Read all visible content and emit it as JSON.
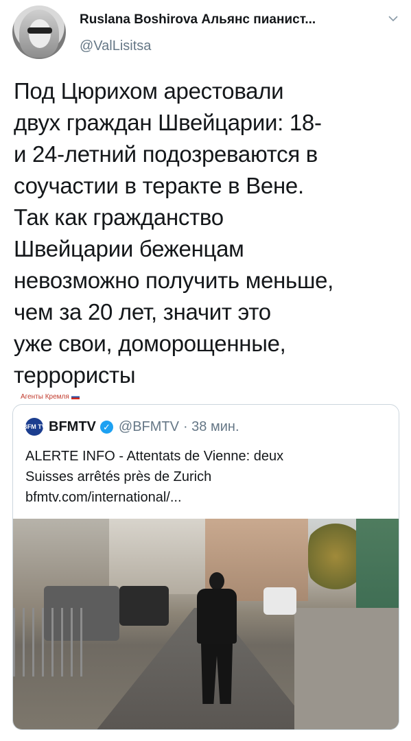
{
  "tweet": {
    "display_name": "Ruslana Boshirova Альянс пианист...",
    "handle": "@ValLisitsa",
    "text": "Под Цюрихом арестовали\nдвух граждан Швейцарии: 18-\nи 24-летний подозреваются в\nсоучастии в теракте в Вене.\nТак как гражданство\nШвейцарии беженцам\nневозможно получить меньше,\nчем за 20 лет, значит это\nуже свои, доморощенные,\nтеррористы",
    "more_icon": "chevron-down-icon"
  },
  "watermark": {
    "text": "Агенты Кремля"
  },
  "quoted": {
    "logo_text": "BFM TV",
    "name": "BFMTV",
    "handle": "@BFMTV",
    "time": "· 38 мин.",
    "text": "ALERTE INFO - Attentats de Vienne: deux\nSuisses arrêtés près de Zurich\nbfmtv.com/international/...",
    "image_desc": "police-officer-street-photo"
  },
  "colors": {
    "text": "#14171a",
    "secondary": "#657786",
    "verified": "#1da1f2",
    "border": "#ccd6dd"
  }
}
